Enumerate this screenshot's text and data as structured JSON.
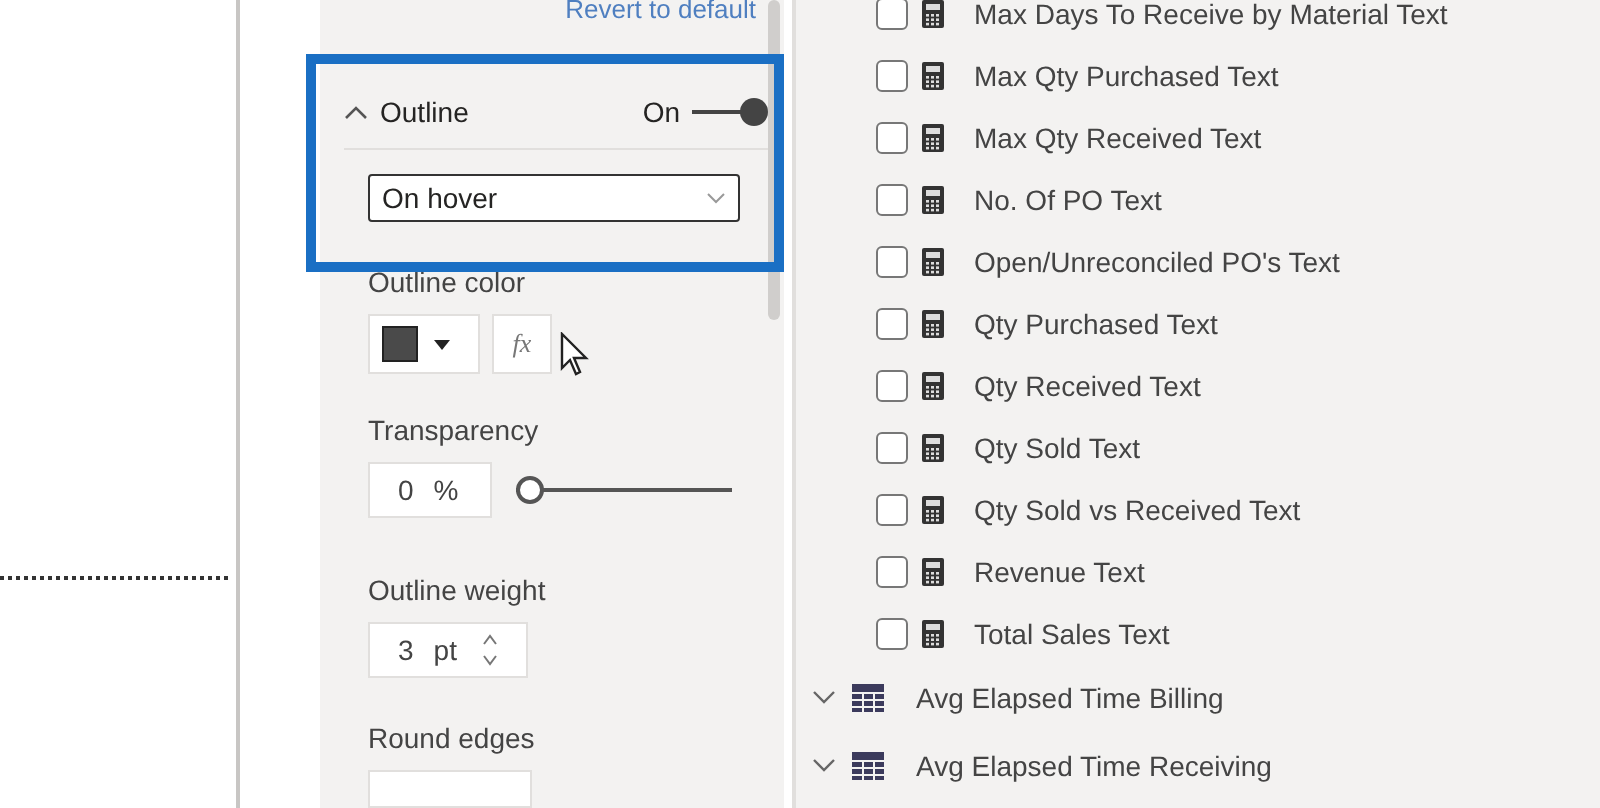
{
  "format_pane": {
    "revert_link": "Revert to default",
    "outline": {
      "title": "Outline",
      "expanded": true,
      "toggle_label": "On",
      "on": true,
      "mode": "On hover"
    },
    "outline_color": {
      "label": "Outline color",
      "color": "#4a4a4a",
      "fx": "fx"
    },
    "transparency": {
      "label": "Transparency",
      "value": "0",
      "unit": "%",
      "level": 0
    },
    "outline_weight": {
      "label": "Outline weight",
      "value": "3",
      "unit": "pt"
    },
    "round_edges": {
      "label": "Round edges"
    }
  },
  "fields": {
    "measures": [
      {
        "name": "Max Days To Receive by Material Text",
        "checked": false
      },
      {
        "name": "Max Qty Purchased Text",
        "checked": false
      },
      {
        "name": "Max Qty Received Text",
        "checked": false
      },
      {
        "name": "No. Of PO Text",
        "checked": false
      },
      {
        "name": "Open/Unreconciled PO's Text",
        "checked": false
      },
      {
        "name": "Qty Purchased Text",
        "checked": false
      },
      {
        "name": "Qty Received Text",
        "checked": false
      },
      {
        "name": "Qty Sold Text",
        "checked": false
      },
      {
        "name": "Qty Sold vs Received Text",
        "checked": false
      },
      {
        "name": "Revenue Text",
        "checked": false
      },
      {
        "name": "Total Sales Text",
        "checked": false
      }
    ],
    "tables": [
      {
        "name": "Avg Elapsed Time Billing",
        "expanded": false
      },
      {
        "name": "Avg Elapsed Time Receiving",
        "expanded": false
      }
    ]
  }
}
